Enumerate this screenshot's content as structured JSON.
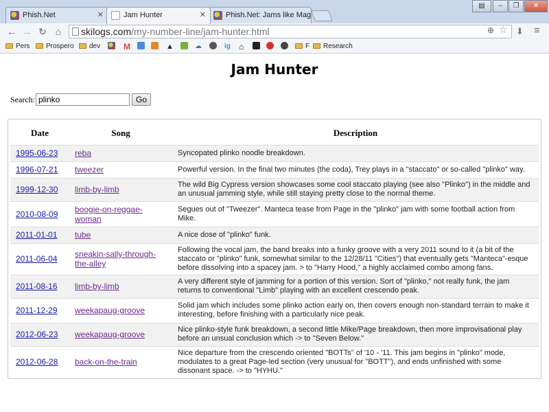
{
  "browser": {
    "tabs": [
      {
        "title": "Phish.Net",
        "active": false
      },
      {
        "title": "Jam Hunter",
        "active": true
      },
      {
        "title": "Phish.Net: Jams like Magn",
        "active": false
      }
    ],
    "url": {
      "host": "skilogs.com",
      "path": "/my-number-line/jam-hunter.html"
    },
    "bookmarks": [
      {
        "label": "Pers",
        "kind": "folder"
      },
      {
        "label": "Prospero",
        "kind": "folder"
      },
      {
        "label": "dev",
        "kind": "folder"
      },
      {
        "label": "F",
        "kind": "folder"
      },
      {
        "label": "Research",
        "kind": "folder"
      }
    ]
  },
  "page": {
    "title": "Jam Hunter",
    "search": {
      "label": "Search:",
      "value": "plinko",
      "button": "Go"
    },
    "table": {
      "headers": {
        "date": "Date",
        "song": "Song",
        "description": "Description"
      },
      "rows": [
        {
          "date": "1995-06-23",
          "song": "reba",
          "description": "Syncopated plinko noodle breakdown."
        },
        {
          "date": "1996-07-21",
          "song": "tweezer",
          "description": "Powerful version. In the final two minutes (the coda), Trey plays in a \"staccato\" or so-called \"plinko\" way."
        },
        {
          "date": "1999-12-30",
          "song": "limb-by-limb",
          "description": "The wild Big Cypress version showcases some cool staccato playing (see also \"Plinko\") in the middle and an unusual jamming style, while still staying pretty close to the normal theme."
        },
        {
          "date": "2010-08-09",
          "song": "boogie-on-reggae-woman",
          "description": "Segues out of \"Tweezer\". Manteca tease from Page in the \"plinko\" jam with some football action from Mike."
        },
        {
          "date": "2011-01-01",
          "song": "tube",
          "description": "A nice dose of \"plinko\" funk."
        },
        {
          "date": "2011-06-04",
          "song": "sneakin-sally-through-the-alley",
          "description": "Following the vocal jam, the band breaks into a funky groove with a very 2011 sound to it (a bit of the staccato or \"plinko\" funk, somewhat similar to the 12/28/11 \"Cities\") that eventually gets \"Manteca\"-esque before dissolving into a spacey jam. > to \"Harry Hood,\" a highly acclaimed combo among fans."
        },
        {
          "date": "2011-08-16",
          "song": "limb-by-limb",
          "description": "A very different style of jamming for a portion of this version. Sort of \"plinko,\" not really funk, the jam returns to conventional \"Limb\" playing with an excellent crescendo peak."
        },
        {
          "date": "2011-12-29",
          "song": "weekapaug-groove",
          "description": "Solid jam which includes some plinko action early on, then covers enough non-standard terrain to make it interesting, before finishing with a particularly nice peak."
        },
        {
          "date": "2012-06-23",
          "song": "weekapaug-groove",
          "description": "Nice plinko-style funk breakdown, a second little Mike/Page breakdown, then more improvisational play before an unsual conclusion which -> to \"Seven Below.\""
        },
        {
          "date": "2012-06-28",
          "song": "back-on-the-train",
          "description": "Nice departure from the crescendo oriented \"BOTTs\" of '10 - '11. This jam begins in \"plinko\" mode, modulates to a great Page-led section (very unusual for \"BOTT\"), and ends unfinished with some dissonant space. -> to \"HYHU.\""
        }
      ]
    }
  }
}
